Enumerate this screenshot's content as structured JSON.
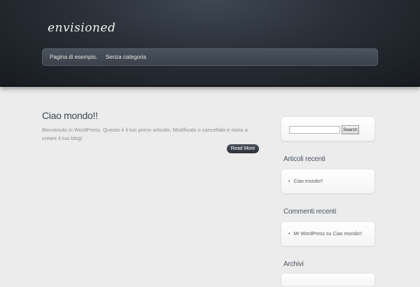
{
  "site": {
    "title": "envisioned"
  },
  "nav": {
    "items": [
      "Pagina di esempio.",
      "Senza categoria"
    ]
  },
  "post": {
    "title": "Ciao mondo!!",
    "excerpt": "Benvenuto in WordPress. Questo è il tuo primo articolo. Modificalo o cancellalo e inizia a creare il tuo blog!",
    "read_more": "Read More"
  },
  "sidebar": {
    "search_button": "Search",
    "search_value": "",
    "recent_posts": {
      "title": "Articoli recenti",
      "items": [
        "Ciao mondo!!"
      ]
    },
    "recent_comments": {
      "title": "Commenti recenti",
      "author": "Mr WordPress",
      "connector": "su",
      "post": "Ciao mondo!!"
    },
    "archives": {
      "title": "Archivi"
    }
  }
}
